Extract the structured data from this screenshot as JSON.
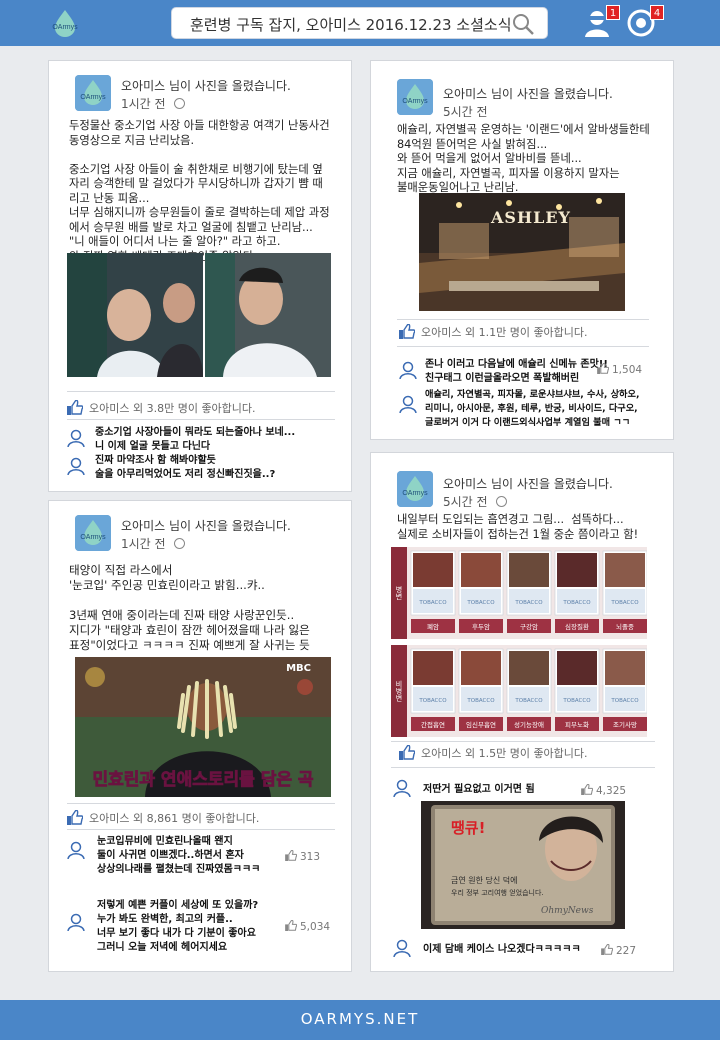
{
  "header": {
    "logo_text": "OArmys",
    "search_text": "훈련병 구독 잡지, 오아미스 2016.12.23 소셜소식",
    "notifications_count": "1",
    "messages_count": "4"
  },
  "posts": [
    {
      "user": "오아미스 님이 사진을 올렸습니다.",
      "time": "1시간 전",
      "lines": [
        "두정물산 중소기업 사장 아들 대한항공 여객기 난동사건",
        "동영상으로 지금 난리났음.",
        "",
        "중소기업 사장 아들이 술 취한채로 비행기에 탔는데 옆",
        "자리 승객한테 말 걸었다가 무시당하니까 갑자기 뺨 때",
        "리고 난동 피움...",
        "너무 심해지니까 승무원들이 줄로 결박하는데 제압 과정",
        "에서 승무원 배를 발로 차고 얼굴에 침뱉고 난리남...",
        "\"니 애들이 어디서 나는 줄 알아?\" 라고 하고.",
        "와 진짜 영화 베테랑 조태호인줄 알았다"
      ],
      "likes": "오아미스 외 3.8만 명이 좋아합니다.",
      "comments": [
        {
          "text": "중소기업 사장아들이 뭐라도 되는줄아나 보네...\n니 이제 얼굴 못들고 다닌다"
        },
        {
          "text": "진짜 마약조사 함 해봐야할듯\n술을 아무리먹었어도 저리 정신빠진짓을..?"
        }
      ]
    },
    {
      "user": "오아미스 님이 사진을 올렸습니다.",
      "time": "1시간 전",
      "lines": [
        "태양이 직접 라스에서",
        "'눈코입' 주인공 민효린이라고 밝힘...캬..",
        "",
        "3년째 연애 중이라는데 진짜 태양 사랑꾼인듯..",
        "지디가 \"태양과 효린이 잠깐 헤어졌을때 나라 잃은",
        "표정\"이었다고 ㅋㅋㅋㅋ 진짜 예쁘게 잘 사귀는 듯"
      ],
      "image_caption": "민효린과 연애스토리를 담은 곡",
      "broadcaster": "MBC",
      "likes": "오아미스 외 8,861 명이 좋아합니다.",
      "comments": [
        {
          "text": "눈코입뮤비에 민효린나올때 왠지\n둘이 사귀면 이쁘겠다..하면서 혼자\n상상의나래를 펼쳤는데 진짜였몸ㅋㅋㅋ",
          "likes": "313"
        },
        {
          "text": "저렇게 예쁜 커플이 세상에 또 있을까?\n누가 봐도 완벽한, 최고의 커플..\n너무 보기 좋다 내가 다 기분이 좋아요\n그러니 오늘 저녁에 헤어지세요",
          "likes": "5,034"
        }
      ]
    },
    {
      "user": "오아미스 님이 사진을 올렸습니다.",
      "time": "5시간 전",
      "lines": [
        "애슐리, 자연별곡 운영하는 '이랜드'에서 알바생들한테",
        "84억원 뜯어먹은 사실 밝혀짐...",
        "와 뜯어 먹을게 없어서 알바비를 뜯네...",
        "지금 애슐리, 자연별곡, 피자몰 이용하지 말자는",
        "불매운동일어나고 난리남."
      ],
      "image_sign": "ASHLEY",
      "likes": "오아미스 외 1.1만 명이 좋아합니다.",
      "comments": [
        {
          "text": "존나 이러고 다음날에 애슐리 신메뉴 존맛!!\n친구태그 이런글올라오면 폭발해버린",
          "likes": "1,504"
        },
        {
          "text": "애슐리, 자연별곡, 피자몰, 로운샤브샤브, 수사, 상하오,\n리미니, 아시아문, 후원, 테루, 반궁, 비사이드, 다구오,\n글로버거 이거 다 이랜드외식사업부 계열임 불매 ㄱㄱ"
        }
      ]
    },
    {
      "user": "오아미스 님이 사진을 올렸습니다.",
      "time": "5시간 전",
      "lines": [
        "내일부터 도입되는 흡연경고 그림...  섬뜩하다...",
        "실제로 소비자들이 접하는건 1월 중순 쯤이라고 함!"
      ],
      "warning_rows": [
        {
          "label": "병변",
          "captions": [
            "폐암",
            "후두암",
            "구강암",
            "심장질환",
            "뇌졸중"
          ]
        },
        {
          "label": "비병변",
          "captions": [
            "간접흡연",
            "임신부흡연",
            "성기능장애",
            "피부노화",
            "조기사망"
          ]
        }
      ],
      "pack_text": "TOBACCO",
      "likes": "오아미스 외 1.5만 명이 좋아합니다.",
      "comments": [
        {
          "text": "저딴거 필요없고 이거면 됨",
          "likes": "4,325"
        },
        {
          "text": "이제 담배 케이스 나오겠다ㅋㅋㅋㅋㅋ",
          "likes": "227"
        }
      ],
      "case_title": "땡큐!",
      "case_line1": "금연 원한 당신 덕에",
      "case_line2": "우리 정부 고리여행 얻었습니다.",
      "case_mark": "OhmyNews"
    }
  ],
  "footer": {
    "text": "OARMYS.NET"
  }
}
